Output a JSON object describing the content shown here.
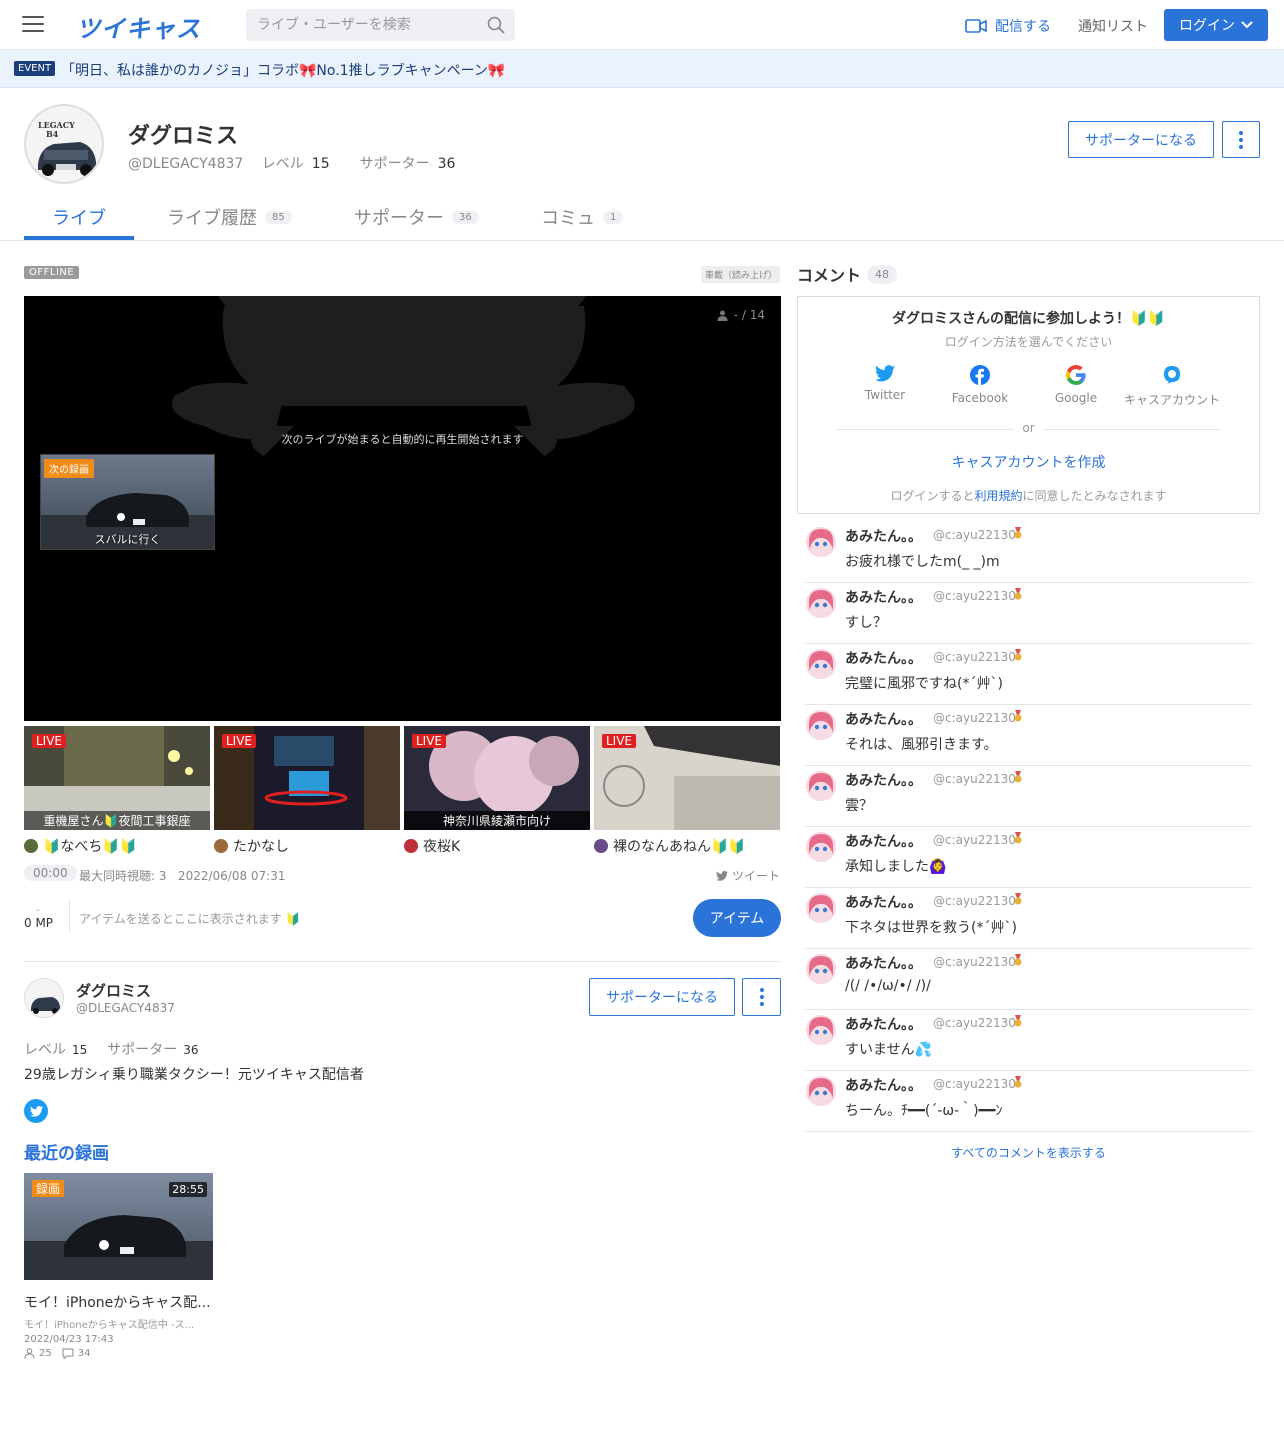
{
  "header": {
    "logo": "ツイキャス",
    "search_placeholder": "ライブ・ユーザーを検索",
    "broadcast_label": "配信する",
    "notify_label": "通知リスト",
    "login_label": "ログイン"
  },
  "event": {
    "badge": "EVENT",
    "text": "「明日、私は誰かのカノジョ」コラボ🎀No.1推しラブキャンペーン🎀"
  },
  "profile": {
    "name": "ダグロミス",
    "handle": "@DLEGACY4837",
    "level_label": "レベル",
    "level": "15",
    "supporter_label": "サポーター",
    "supporters": "36",
    "support_button": "サポーターになる",
    "avatar_text_1": "LEGACY",
    "avatar_text_2": "B4"
  },
  "tabs": [
    {
      "label": "ライブ",
      "count": ""
    },
    {
      "label": "ライブ履歴",
      "count": "85"
    },
    {
      "label": "サポーター",
      "count": "36"
    },
    {
      "label": "コミュ",
      "count": "1"
    }
  ],
  "player": {
    "status": "OFFLINE",
    "genre": "車載（読み上げ）",
    "viewers": "- / 14",
    "autoplay_text": "次のライブが始まると自動的に再生開始されます",
    "next_badge": "次の録画",
    "next_title": "スバルに行く"
  },
  "live_cards": [
    {
      "badge": "LIVE",
      "caption": "重機屋さん🔰夜間工事銀座",
      "user": "🔰なべち🔰🔰",
      "avatar_color": "#5a6b3a"
    },
    {
      "badge": "LIVE",
      "caption": "",
      "user": "たかなし",
      "avatar_color": "#9a6a3a"
    },
    {
      "badge": "LIVE",
      "caption": "神奈川県綾瀬市向け",
      "user": "夜桜K",
      "avatar_color": "#c0303a"
    },
    {
      "badge": "LIVE",
      "caption": "",
      "user": "裸のなんあねん🔰🔰",
      "avatar_color": "#6a4a8a"
    }
  ],
  "stream_info": {
    "time": "00:00",
    "meta": "最大同時視聴: 3   2022/06/08 07:31",
    "tweet_label": "ツイート",
    "mp_dash": "-",
    "mp": "0 MP",
    "items_hint": "アイテムを送るとここに表示されます 🔰",
    "item_button": "アイテム"
  },
  "profile2": {
    "name": "ダグロミス",
    "handle": "@DLEGACY4837",
    "support_button": "サポーターになる",
    "level_label": "レベル",
    "level": "15",
    "supporter_label": "サポーター",
    "supporters": "36",
    "bio": "29歳レガシィ乗り職業タクシー！元ツイキャス配信者"
  },
  "recent": {
    "title": "最近の録画",
    "badge": "録画",
    "duration": "28:55",
    "video_title": "モイ！iPhoneからキャス配...",
    "video_sub": "モイ！iPhoneからキャス配信中 -ス...",
    "date": "2022/04/23 17:43",
    "views": "25",
    "comments": "34"
  },
  "comments_panel": {
    "title": "コメント",
    "count": "48",
    "join_title": "ダグロミスさんの配信に参加しよう！🔰🔰",
    "join_sub": "ログイン方法を選んでください",
    "sns": [
      "Twitter",
      "Facebook",
      "Google",
      "キャスアカウント"
    ],
    "or": "or",
    "create": "キャスアカウントを作成",
    "terms_before": "ログインすると",
    "terms_link": "利用規約",
    "terms_after": "に同意したとみなされます",
    "show_all": "すべてのコメントを表示する"
  },
  "comments": [
    {
      "name": "あみたん。。",
      "handle": "@c:ayu22130",
      "text": "お疲れ様でしたm(_ _)m"
    },
    {
      "name": "あみたん。。",
      "handle": "@c:ayu22130",
      "text": "すし？"
    },
    {
      "name": "あみたん。。",
      "handle": "@c:ayu22130",
      "text": "完璧に風邪ですね(*´艸`)"
    },
    {
      "name": "あみたん。。",
      "handle": "@c:ayu22130",
      "text": "それは、風邪引きます。"
    },
    {
      "name": "あみたん。。",
      "handle": "@c:ayu22130",
      "text": "雲？"
    },
    {
      "name": "あみたん。。",
      "handle": "@c:ayu22130",
      "text": "承知しました🙆‍♀"
    },
    {
      "name": "あみたん。。",
      "handle": "@c:ayu22130",
      "text": "下ネタは世界を救う(*´艸`)"
    },
    {
      "name": "あみたん。。",
      "handle": "@c:ayu22130",
      "text": "/(/ /•/ω/•/ /)/"
    },
    {
      "name": "あみたん。。",
      "handle": "@c:ayu22130",
      "text": "すいません💦"
    },
    {
      "name": "あみたん。。",
      "handle": "@c:ayu22130",
      "text": "ちーん。ﾁ━━(´-ω-｀)━━ﾝ"
    }
  ],
  "colors": {
    "accent": "#2a73d9",
    "live": "#e02020",
    "recording": "#f08c1a",
    "event_bg": "#eaf2fd"
  }
}
